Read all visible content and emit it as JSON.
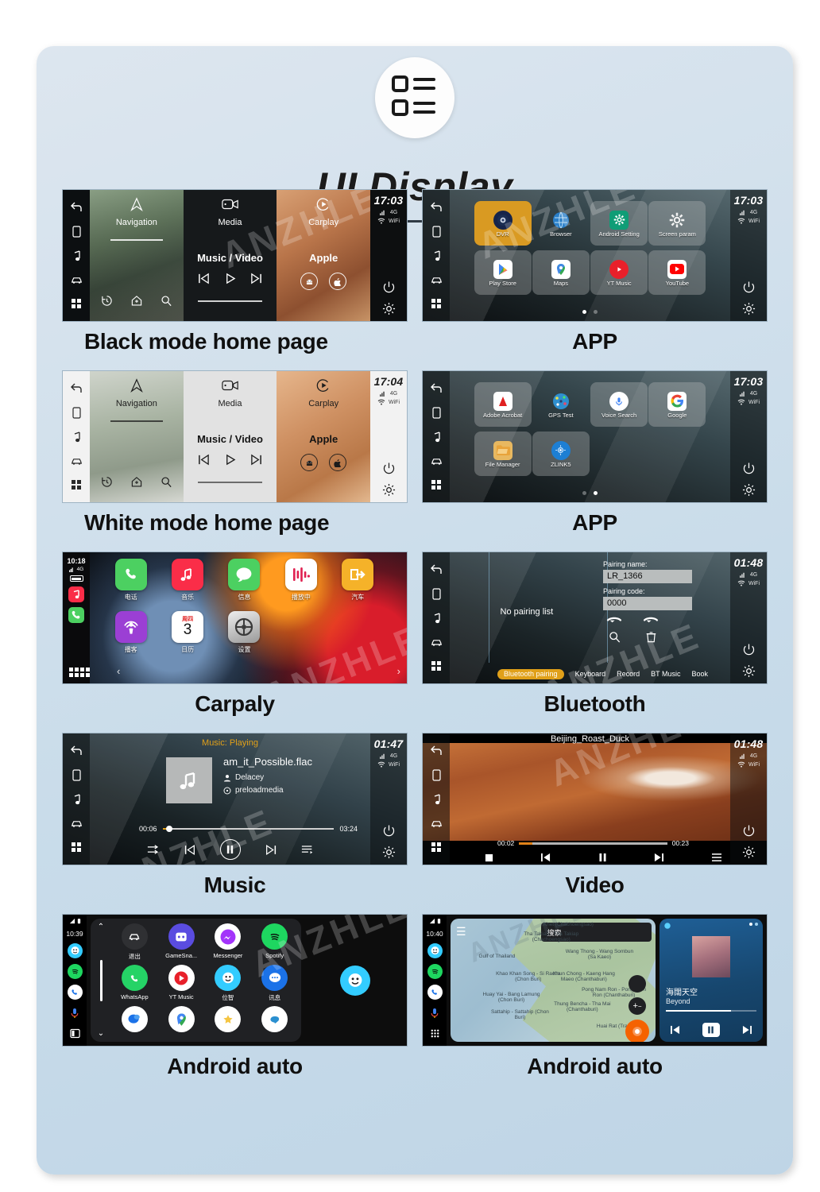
{
  "header": {
    "title": "UI Display",
    "badge_icon": "list-grid-icon"
  },
  "watermark": "ANZHLE",
  "panels": [
    {
      "caption": "Black mode home page",
      "type": "home-dark",
      "status": {
        "time": "17:03",
        "network": "4G",
        "wifi": "WiFi"
      },
      "tiles": [
        {
          "icon": "navigation-arrow-icon",
          "label": "Navigation",
          "sub": "",
          "controls": [
            "history-icon",
            "home-pin-icon",
            "search-icon"
          ]
        },
        {
          "icon": "media-video-icon",
          "label": "Media",
          "sub": "Music / Video",
          "controls": [
            "prev-icon",
            "play-icon",
            "next-icon"
          ]
        },
        {
          "icon": "carplay-icon",
          "label": "Carplay",
          "sub": "Apple",
          "controls": [
            "android-icon",
            "apple-icon"
          ]
        }
      ]
    },
    {
      "caption": "APP",
      "type": "app-grid",
      "status": {
        "time": "17:03",
        "network": "4G",
        "wifi": "WiFi"
      },
      "page_dots": {
        "count": 2,
        "active": 0
      },
      "apps": [
        {
          "name": "DVR",
          "icon": "dvr-icon",
          "color": "#1b2d52",
          "highlight": true
        },
        {
          "name": "Browser",
          "icon": "browser-icon",
          "color": "#2a7fc9",
          "plain": true
        },
        {
          "name": "Android Setting",
          "icon": "gear-icon",
          "color": "#0f9d76"
        },
        {
          "name": "Screen param",
          "icon": "gear-icon",
          "color": "#ffffff"
        },
        {
          "name": "Play Store",
          "icon": "play-store-icon",
          "color": "#ffffff"
        },
        {
          "name": "Maps",
          "icon": "maps-pin-icon",
          "color": "#ffffff"
        },
        {
          "name": "YT Music",
          "icon": "yt-music-icon",
          "color": "#e8202a"
        },
        {
          "name": "YouTube",
          "icon": "youtube-icon",
          "color": "#ffffff"
        }
      ]
    },
    {
      "caption": "White mode home page",
      "type": "home-light",
      "status": {
        "time": "17:04",
        "network": "4G",
        "wifi": "WiFi"
      },
      "tiles": [
        {
          "icon": "navigation-arrow-icon",
          "label": "Navigation",
          "sub": "",
          "controls": [
            "history-icon",
            "home-pin-icon",
            "search-icon"
          ]
        },
        {
          "icon": "media-video-icon",
          "label": "Media",
          "sub": "Music / Video",
          "controls": [
            "prev-icon",
            "play-icon",
            "next-icon"
          ]
        },
        {
          "icon": "carplay-icon",
          "label": "Carplay",
          "sub": "Apple",
          "controls": [
            "android-icon",
            "apple-icon"
          ]
        }
      ]
    },
    {
      "caption": "APP",
      "type": "app-grid",
      "status": {
        "time": "17:03",
        "network": "4G",
        "wifi": "WiFi"
      },
      "page_dots": {
        "count": 2,
        "active": 1
      },
      "apps": [
        {
          "name": "Adobe Acrobat",
          "icon": "adobe-acrobat-icon",
          "color": "#ffffff"
        },
        {
          "name": "GPS Test",
          "icon": "gps-test-icon",
          "color": "#ffffff",
          "plain": true
        },
        {
          "name": "Voice Search",
          "icon": "voice-search-icon",
          "color": "#ffffff"
        },
        {
          "name": "Google",
          "icon": "google-icon",
          "color": "#ffffff"
        },
        {
          "name": "File Manager",
          "icon": "file-manager-icon",
          "color": "#e8b860"
        },
        {
          "name": "ZLINK5",
          "icon": "zlink5-icon",
          "color": "#1d7fd4"
        }
      ]
    },
    {
      "caption": "Carpaly",
      "type": "carplay",
      "status": {
        "time": "10:18",
        "network": "4G"
      },
      "dock": [
        "music-icon",
        "phone-icon"
      ],
      "apps": [
        {
          "name": "电话",
          "icon": "phone-icon",
          "color": "#4cd061"
        },
        {
          "name": "音乐",
          "icon": "music-note-icon",
          "color": "#fa2d48"
        },
        {
          "name": "信息",
          "icon": "messages-icon",
          "color": "#4cd061"
        },
        {
          "name": "播放中",
          "icon": "now-playing-icon",
          "color": "#ffffff"
        },
        {
          "name": "汽车",
          "icon": "car-exit-icon",
          "color": "#f5b229"
        },
        {
          "name": "播客",
          "icon": "podcasts-icon",
          "color": "#9b3fd4"
        },
        {
          "name": "日历",
          "icon": "calendar-icon",
          "color": "#ffffff",
          "badge_top": "周四",
          "badge_day": "3"
        },
        {
          "name": "设置",
          "icon": "settings-icon",
          "color": "#cccccc"
        }
      ]
    },
    {
      "caption": "Bluetooth",
      "type": "bluetooth",
      "status": {
        "time": "01:48",
        "network": "4G",
        "wifi": "WiFi"
      },
      "empty_list_text": "No pairing list",
      "fields": [
        {
          "label": "Pairing name:",
          "value": "LR_1366"
        },
        {
          "label": "Pairing code:",
          "value": "0000"
        }
      ],
      "actions": [
        "answer-call-icon",
        "end-call-icon",
        "search-icon",
        "delete-icon"
      ],
      "tabs": [
        {
          "label": "Bluetooth pairing",
          "active": true
        },
        {
          "label": "Keyboard",
          "active": false
        },
        {
          "label": "Record",
          "active": false
        },
        {
          "label": "BT Music",
          "active": false
        },
        {
          "label": "Book",
          "active": false
        }
      ]
    },
    {
      "caption": "Music",
      "type": "music",
      "status": {
        "time": "01:47",
        "network": "4G",
        "wifi": "WiFi"
      },
      "header_text": "Music: Playing",
      "track": {
        "title": "am_it_Possible.flac",
        "artist": "Delacey",
        "source": "preloadmedia",
        "elapsed": "00:06",
        "duration": "03:24"
      },
      "controls": [
        "shuffle-icon",
        "prev-icon",
        "pause-icon",
        "next-icon",
        "playlist-icon"
      ]
    },
    {
      "caption": "Video",
      "type": "video",
      "status": {
        "time": "01:48",
        "network": "4G",
        "wifi": "WiFi"
      },
      "title": "Beijing_Roast_Duck",
      "elapsed": "00:02",
      "duration": "00:23",
      "controls": [
        "stop-icon",
        "prev-icon",
        "pause-icon",
        "next-icon",
        "playlist-icon"
      ]
    },
    {
      "caption": "Android auto",
      "type": "android-auto-apps",
      "status": {
        "time": "10:39"
      },
      "rail": [
        "waze-icon",
        "spotify-icon",
        "phone-icon",
        "mic-icon",
        "split-screen-icon"
      ],
      "apps": [
        {
          "name": "退出",
          "icon": "exit-car-icon",
          "color": "#2f3033"
        },
        {
          "name": "GameSna...",
          "icon": "gamesnacks-icon",
          "color": "#5a4ce0"
        },
        {
          "name": "Messenger",
          "icon": "messenger-icon",
          "color": "#ffffff"
        },
        {
          "name": "Spotify",
          "icon": "spotify-icon",
          "color": "#1ed760"
        },
        {
          "name": "WhatsApp",
          "icon": "whatsapp-icon",
          "color": "#25d366"
        },
        {
          "name": "YT Music",
          "icon": "yt-music-icon",
          "color": "#e8202a"
        },
        {
          "name": "位智",
          "icon": "waze-icon",
          "color": "#33ccff"
        },
        {
          "name": "讯息",
          "icon": "messages-icon",
          "color": "#1b72e8"
        },
        {
          "name": "",
          "icon": "sms-icon",
          "color": "#ffffff"
        },
        {
          "name": "",
          "icon": "maps-pin-icon",
          "color": "#ffffff"
        },
        {
          "name": "",
          "icon": "contacts-icon",
          "color": "#ffffff"
        },
        {
          "name": "",
          "icon": "line-icon",
          "color": "#ffffff"
        }
      ],
      "side_app": "waze-icon"
    },
    {
      "caption": "Android auto",
      "type": "android-auto-map",
      "status": {
        "time": "10:40"
      },
      "rail": [
        "waze-icon",
        "spotify-icon",
        "phone-icon",
        "mic-icon",
        "apps-grid-icon"
      ],
      "search_placeholder": "搜索",
      "map_labels": [
        "Khet (Chachoengsao)",
        "Tha Takiap - Tha Takiap (Chachoengsao)",
        "Wang Thong - Wang Sombun (Sa Kaeo)",
        "Gulf of Thailand",
        "Khao Khan Song - Si Racha (Chon Buri)",
        "Khun Chong - Kaeng Hang Maeo (Chanthaburi)",
        "Pong Nam Ron - Pong Nam Ron (Chanthaburi)",
        "Huay Yai - Bang Lamung (Chon Buri)",
        "Thung Bencha - Tha Mai (Chanthaburi)",
        "Sattahip - Sattahip (Chon Buri)",
        "Huai Rat (Trat)"
      ],
      "player": {
        "title": "海闊天空",
        "artist": "Beyond",
        "controls": [
          "prev-icon",
          "pause-icon",
          "next-icon"
        ]
      }
    }
  ]
}
